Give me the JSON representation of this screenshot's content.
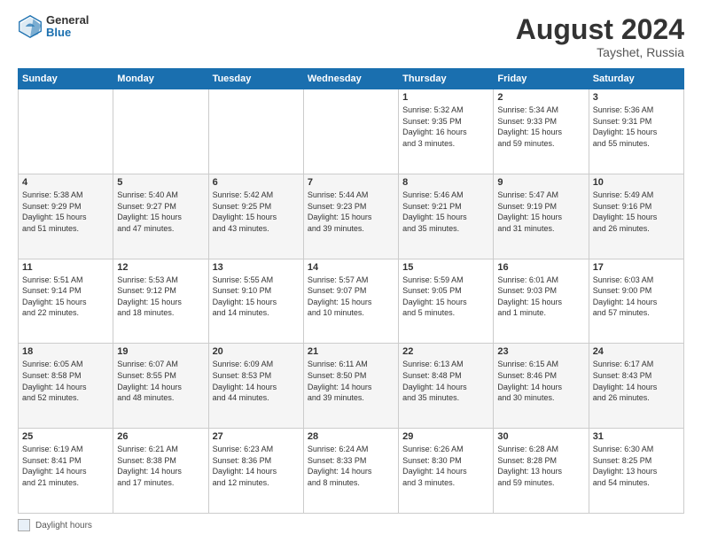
{
  "header": {
    "logo_general": "General",
    "logo_blue": "Blue",
    "month_year": "August 2024",
    "location": "Tayshet, Russia"
  },
  "footer": {
    "daylight_label": "Daylight hours"
  },
  "calendar": {
    "days_of_week": [
      "Sunday",
      "Monday",
      "Tuesday",
      "Wednesday",
      "Thursday",
      "Friday",
      "Saturday"
    ],
    "rows": [
      [
        {
          "day": "",
          "info": ""
        },
        {
          "day": "",
          "info": ""
        },
        {
          "day": "",
          "info": ""
        },
        {
          "day": "",
          "info": ""
        },
        {
          "day": "1",
          "info": "Sunrise: 5:32 AM\nSunset: 9:35 PM\nDaylight: 16 hours\nand 3 minutes."
        },
        {
          "day": "2",
          "info": "Sunrise: 5:34 AM\nSunset: 9:33 PM\nDaylight: 15 hours\nand 59 minutes."
        },
        {
          "day": "3",
          "info": "Sunrise: 5:36 AM\nSunset: 9:31 PM\nDaylight: 15 hours\nand 55 minutes."
        }
      ],
      [
        {
          "day": "4",
          "info": "Sunrise: 5:38 AM\nSunset: 9:29 PM\nDaylight: 15 hours\nand 51 minutes."
        },
        {
          "day": "5",
          "info": "Sunrise: 5:40 AM\nSunset: 9:27 PM\nDaylight: 15 hours\nand 47 minutes."
        },
        {
          "day": "6",
          "info": "Sunrise: 5:42 AM\nSunset: 9:25 PM\nDaylight: 15 hours\nand 43 minutes."
        },
        {
          "day": "7",
          "info": "Sunrise: 5:44 AM\nSunset: 9:23 PM\nDaylight: 15 hours\nand 39 minutes."
        },
        {
          "day": "8",
          "info": "Sunrise: 5:46 AM\nSunset: 9:21 PM\nDaylight: 15 hours\nand 35 minutes."
        },
        {
          "day": "9",
          "info": "Sunrise: 5:47 AM\nSunset: 9:19 PM\nDaylight: 15 hours\nand 31 minutes."
        },
        {
          "day": "10",
          "info": "Sunrise: 5:49 AM\nSunset: 9:16 PM\nDaylight: 15 hours\nand 26 minutes."
        }
      ],
      [
        {
          "day": "11",
          "info": "Sunrise: 5:51 AM\nSunset: 9:14 PM\nDaylight: 15 hours\nand 22 minutes."
        },
        {
          "day": "12",
          "info": "Sunrise: 5:53 AM\nSunset: 9:12 PM\nDaylight: 15 hours\nand 18 minutes."
        },
        {
          "day": "13",
          "info": "Sunrise: 5:55 AM\nSunset: 9:10 PM\nDaylight: 15 hours\nand 14 minutes."
        },
        {
          "day": "14",
          "info": "Sunrise: 5:57 AM\nSunset: 9:07 PM\nDaylight: 15 hours\nand 10 minutes."
        },
        {
          "day": "15",
          "info": "Sunrise: 5:59 AM\nSunset: 9:05 PM\nDaylight: 15 hours\nand 5 minutes."
        },
        {
          "day": "16",
          "info": "Sunrise: 6:01 AM\nSunset: 9:03 PM\nDaylight: 15 hours\nand 1 minute."
        },
        {
          "day": "17",
          "info": "Sunrise: 6:03 AM\nSunset: 9:00 PM\nDaylight: 14 hours\nand 57 minutes."
        }
      ],
      [
        {
          "day": "18",
          "info": "Sunrise: 6:05 AM\nSunset: 8:58 PM\nDaylight: 14 hours\nand 52 minutes."
        },
        {
          "day": "19",
          "info": "Sunrise: 6:07 AM\nSunset: 8:55 PM\nDaylight: 14 hours\nand 48 minutes."
        },
        {
          "day": "20",
          "info": "Sunrise: 6:09 AM\nSunset: 8:53 PM\nDaylight: 14 hours\nand 44 minutes."
        },
        {
          "day": "21",
          "info": "Sunrise: 6:11 AM\nSunset: 8:50 PM\nDaylight: 14 hours\nand 39 minutes."
        },
        {
          "day": "22",
          "info": "Sunrise: 6:13 AM\nSunset: 8:48 PM\nDaylight: 14 hours\nand 35 minutes."
        },
        {
          "day": "23",
          "info": "Sunrise: 6:15 AM\nSunset: 8:46 PM\nDaylight: 14 hours\nand 30 minutes."
        },
        {
          "day": "24",
          "info": "Sunrise: 6:17 AM\nSunset: 8:43 PM\nDaylight: 14 hours\nand 26 minutes."
        }
      ],
      [
        {
          "day": "25",
          "info": "Sunrise: 6:19 AM\nSunset: 8:41 PM\nDaylight: 14 hours\nand 21 minutes."
        },
        {
          "day": "26",
          "info": "Sunrise: 6:21 AM\nSunset: 8:38 PM\nDaylight: 14 hours\nand 17 minutes."
        },
        {
          "day": "27",
          "info": "Sunrise: 6:23 AM\nSunset: 8:36 PM\nDaylight: 14 hours\nand 12 minutes."
        },
        {
          "day": "28",
          "info": "Sunrise: 6:24 AM\nSunset: 8:33 PM\nDaylight: 14 hours\nand 8 minutes."
        },
        {
          "day": "29",
          "info": "Sunrise: 6:26 AM\nSunset: 8:30 PM\nDaylight: 14 hours\nand 3 minutes."
        },
        {
          "day": "30",
          "info": "Sunrise: 6:28 AM\nSunset: 8:28 PM\nDaylight: 13 hours\nand 59 minutes."
        },
        {
          "day": "31",
          "info": "Sunrise: 6:30 AM\nSunset: 8:25 PM\nDaylight: 13 hours\nand 54 minutes."
        }
      ]
    ]
  }
}
